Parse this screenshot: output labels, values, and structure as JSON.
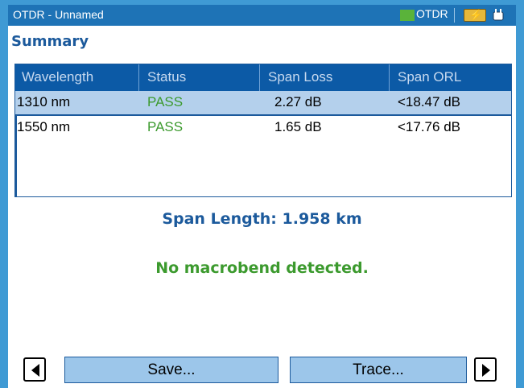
{
  "titlebar": {
    "title": "OTDR - Unnamed",
    "mode_label": "OTDR",
    "mode_color": "#5ab33a",
    "icons": [
      "battery-charging-icon",
      "power-plug-icon"
    ]
  },
  "summary": {
    "title": "Summary"
  },
  "table": {
    "columns": [
      "Wavelength",
      "Status",
      "Span Loss",
      "Span ORL"
    ],
    "rows": [
      {
        "wavelength": "1310 nm",
        "status": "PASS",
        "span_loss": "2.27 dB",
        "span_orl": "<18.47 dB",
        "selected": true
      },
      {
        "wavelength": "1550 nm",
        "status": "PASS",
        "span_loss": "1.65 dB",
        "span_orl": "<17.76 dB",
        "selected": false
      }
    ]
  },
  "span_length": "Span Length: 1.958 km",
  "macrobend_message": "No macrobend detected.",
  "buttons": {
    "prev_icon": "left-arrow-icon",
    "save": "Save...",
    "trace": "Trace...",
    "next_icon": "right-arrow-icon"
  },
  "colors": {
    "background": "#3f9ad4",
    "titlebar": "#1e73b6",
    "header": "#0c5aa6",
    "selected_row": "#b4d0ec",
    "pass": "#3c9a2e",
    "accent_text": "#1c5a9c",
    "button": "#9cc6ea"
  }
}
